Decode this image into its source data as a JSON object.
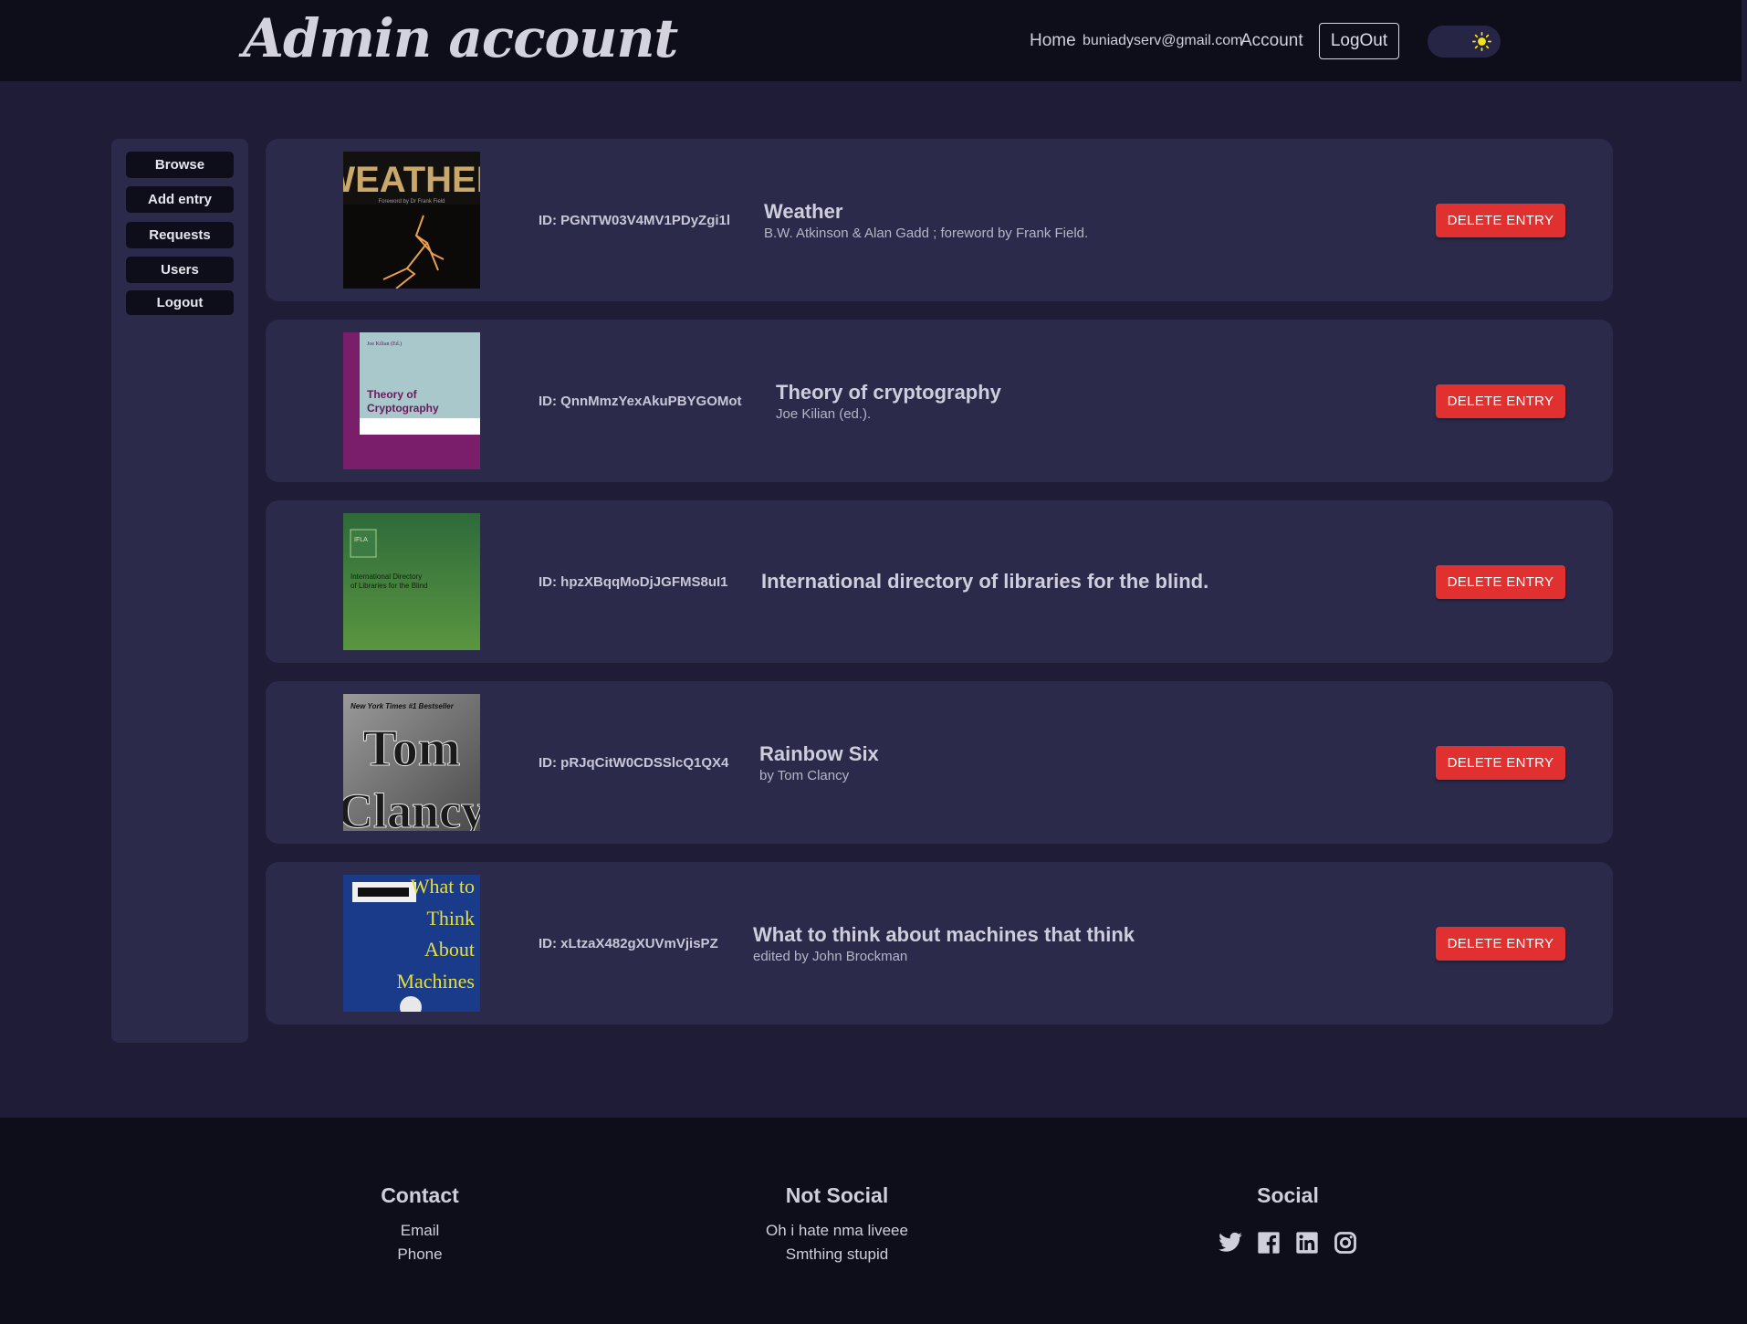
{
  "header": {
    "brand": "Admin account",
    "nav_home": "Home",
    "user_email": "buniadyserv@gmail.com",
    "nav_account": "Account",
    "logout": "LogOut"
  },
  "sidebar": {
    "items": [
      "Browse",
      "Add entry",
      "Requests",
      "Users",
      "Logout"
    ]
  },
  "entries": [
    {
      "id": "ID: PGNTW03V4MV1PDyZgi1l",
      "title": "Weather",
      "author": "B.W. Atkinson & Alan Gadd ; foreword by Frank Field.",
      "cover_text": "WEATHER",
      "cover_sub": "Foreword by Dr Frank Field",
      "delete": "DELETE ENTRY"
    },
    {
      "id": "ID: QnnMmzYexAkuPBYGOMot",
      "title": "Theory of cryptography",
      "author": "Joe Kilian (ed.).",
      "cover_text": "Theory of Cryptography",
      "cover_sub": "Joe Kilian (Ed.)",
      "delete": "DELETE ENTRY"
    },
    {
      "id": "ID: hpzXBqqMoDjJGFMS8uI1",
      "title": "International directory of libraries for the blind.",
      "author": "",
      "cover_text": "International Directory of Libraries for the Blind",
      "cover_sub": "IFLA",
      "delete": "DELETE ENTRY"
    },
    {
      "id": "ID: pRJqCitW0CDSSlcQ1QX4",
      "title": "Rainbow Six",
      "author": "by Tom Clancy",
      "cover_text": "Tom Clancy",
      "cover_sub": "New York Times #1 Bestseller",
      "delete": "DELETE ENTRY"
    },
    {
      "id": "ID: xLtzaX482gXUVmVjisPZ",
      "title": "What to think about machines that think",
      "author": "edited by John Brockman",
      "cover_text": "What to Think About Machines",
      "cover_sub": "",
      "delete": "DELETE ENTRY"
    }
  ],
  "footer": {
    "contact": {
      "heading": "Contact",
      "items": [
        "Email",
        "Phone"
      ]
    },
    "not_social": {
      "heading": "Not Social",
      "items": [
        "Oh i hate nma liveee",
        "Smthing stupid"
      ]
    },
    "social": {
      "heading": "Social",
      "icons": [
        "twitter-icon",
        "facebook-icon",
        "linkedin-icon",
        "instagram-icon"
      ]
    }
  },
  "colors": {
    "background": "#1e1c36",
    "panel": "#2c2a4b",
    "header": "#0e0d1a",
    "danger": "#e0302f",
    "sun": "#f6e21a"
  }
}
